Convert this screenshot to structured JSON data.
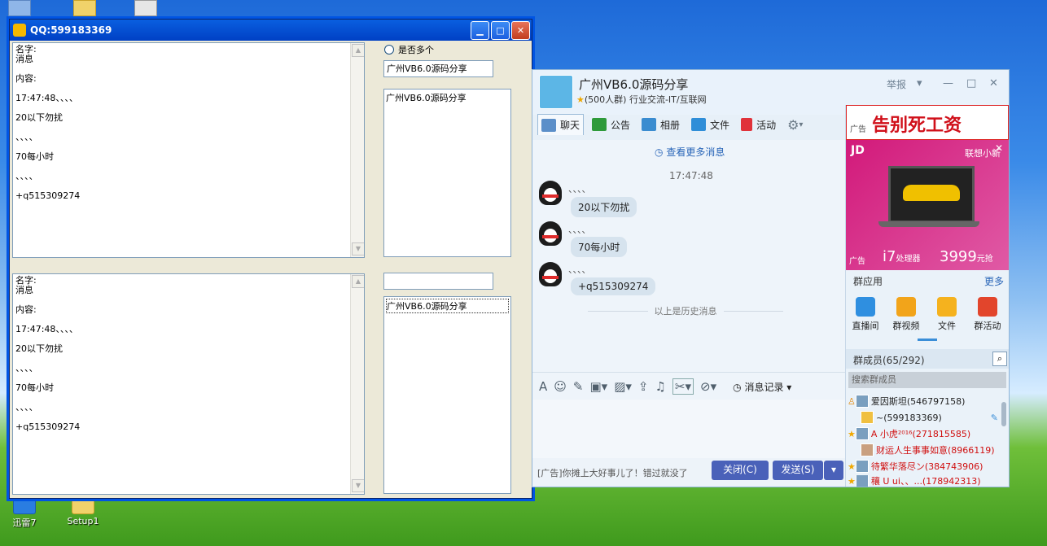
{
  "desktop": {
    "icons": [
      {
        "label": "迅雷7"
      },
      {
        "label": "Setup1"
      }
    ]
  },
  "vb_window": {
    "title": "QQ:599183369",
    "radio_label": "是否多个",
    "textbox1": "广州VB6.0源码分享",
    "textbox2": "",
    "listbox1": [
      "广州VB6.0源码分享"
    ],
    "listbox2": [
      "广州VB6.0源码分享"
    ],
    "text_lines_top": [
      "名字:",
      "消息",
      "",
      "内容:",
      "",
      "17:47:48、、、、",
      "",
      "20以下勿扰",
      "",
      "、、、、",
      "",
      "70每小时",
      "",
      "、、、、",
      "",
      "+q515309274"
    ],
    "text_lines_bottom": [
      "名字:",
      "消息",
      "",
      "内容:",
      "",
      "17:47:48、、、、",
      "",
      "20以下勿扰",
      "",
      "、、、、",
      "",
      "70每小时",
      "",
      "、、、、",
      "",
      "+q515309274"
    ]
  },
  "qq": {
    "group_name": "广州VB6.0源码分享",
    "group_sub": "(500人群) 行业交流-IT/互联网",
    "report": "举报",
    "tabs": [
      {
        "label": "聊天",
        "color": "#5b8fc9"
      },
      {
        "label": "公告",
        "color": "#2e9a3a"
      },
      {
        "label": "相册",
        "color": "#3a8cd0"
      },
      {
        "label": "文件",
        "color": "#2f8ed8"
      },
      {
        "label": "活动",
        "color": "#e0323a"
      }
    ],
    "see_more": "查看更多消息",
    "time": "17:47:48",
    "messages": [
      {
        "dots": "、、、、",
        "text": "20以下勿扰"
      },
      {
        "dots": "、、、、",
        "text": "70每小时"
      },
      {
        "dots": "、、、、",
        "text": "+q515309274"
      }
    ],
    "history_label": "以上是历史消息",
    "msg_record": "消息记录",
    "ad_text": "[广告]你摊上大好事儿了！错过就没了",
    "close_btn": "关闭(C)",
    "send_btn": "发送(S)",
    "side": {
      "ad1": "告别死工资",
      "ad_tag": "广告",
      "ad2_brand": "JD",
      "ad2_right": "联想小新",
      "ad2_cpu": "i7",
      "ad2_cpu_sub": "处理器",
      "ad2_price": "3999",
      "ad2_price_unit": "元抢",
      "apps_title": "群应用",
      "apps_more": "更多",
      "apps": [
        {
          "label": "直播间",
          "color": "#2f8fe0"
        },
        {
          "label": "群视频",
          "color": "#f2a41a"
        },
        {
          "label": "文件",
          "color": "#f5b21e"
        },
        {
          "label": "群活动",
          "color": "#e2452c"
        }
      ],
      "members_title": "群成员(65/292)",
      "search_placeholder": "搜索群成员",
      "members": [
        {
          "name": "爱因斯坦(546797158)",
          "color": "#222222"
        },
        {
          "name": "~(599183369)",
          "color": "#222222"
        },
        {
          "name": "A 小虎²⁰¹⁶(271815585)",
          "color": "#d01010"
        },
        {
          "name": "财运人生事事如意(8966119)",
          "color": "#d01010"
        },
        {
          "name": "待繁华落尽ン(384743906)",
          "color": "#d01010"
        },
        {
          "name": "穰 U ui、、...(178942313)",
          "color": "#d01010"
        }
      ]
    }
  }
}
